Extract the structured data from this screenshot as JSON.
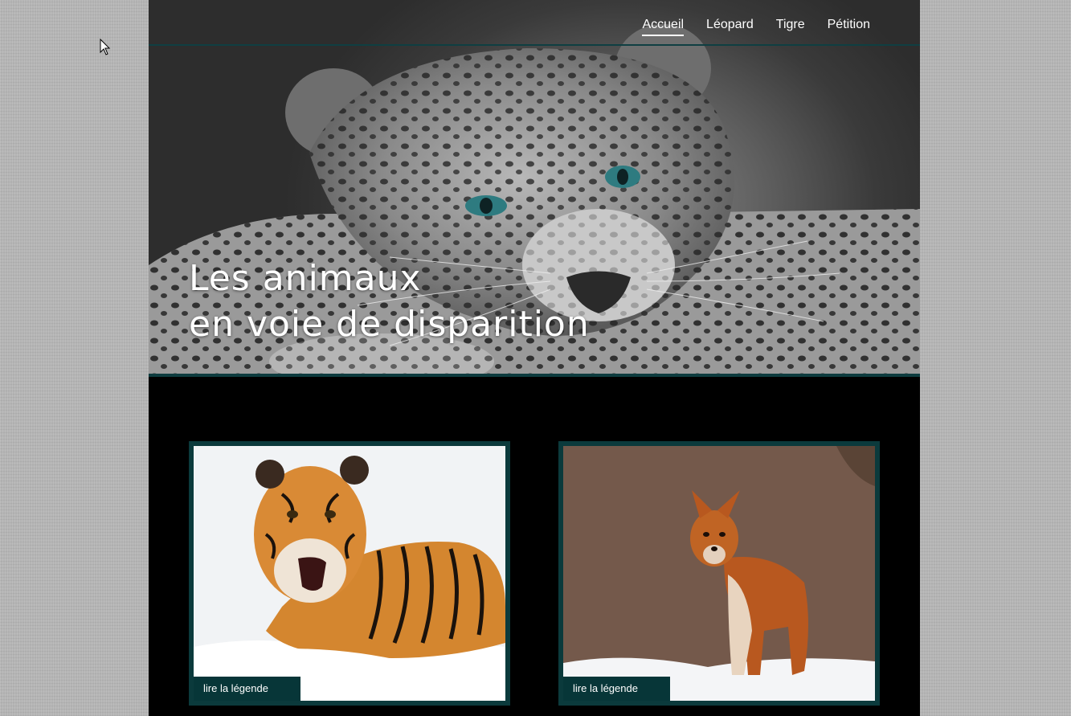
{
  "nav": {
    "items": [
      {
        "label": "Accueil",
        "active": true
      },
      {
        "label": "Léopard",
        "active": false
      },
      {
        "label": "Tigre",
        "active": false
      },
      {
        "label": "Pétition",
        "active": false
      }
    ]
  },
  "hero": {
    "title_line1": "Les animaux",
    "title_line2": "en voie de disparition",
    "image": "leopard-photo"
  },
  "cards": [
    {
      "image": "tiger-photo",
      "caption": "lire la légende"
    },
    {
      "image": "dhole-photo",
      "caption": "lire la légende"
    }
  ],
  "colors": {
    "accent": "#0b3a3c",
    "page_bg": "#000000",
    "outer_bg": "#b4b4b4",
    "nav_text": "#ffffff"
  }
}
